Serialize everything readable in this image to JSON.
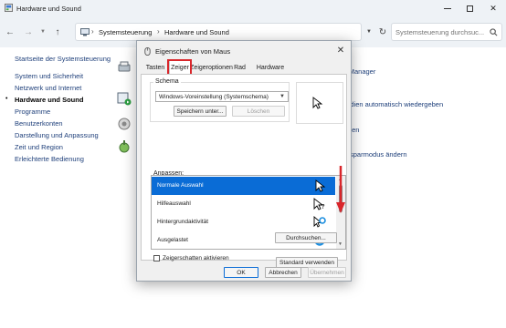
{
  "window": {
    "title": "Hardware und Sound",
    "controls": {
      "minimize": "minimize",
      "maximize": "maximize",
      "close": "✕"
    }
  },
  "address": {
    "breadcrumbs": [
      "Systemsteuerung",
      "Hardware und Sound"
    ],
    "separator": "›",
    "search_placeholder": "Systemsteuerung durchsuc..."
  },
  "sidebar": {
    "items": [
      {
        "label": "Startseite der Systemsteuerung",
        "active": false
      },
      {
        "label": "System und Sicherheit",
        "active": false
      },
      {
        "label": "Netzwerk und Internet",
        "active": false
      },
      {
        "label": "Hardware und Sound",
        "active": true
      },
      {
        "label": "Programme",
        "active": false
      },
      {
        "label": "Benutzerkonten",
        "active": false
      },
      {
        "label": "Darstellung und Anpassung",
        "active": false
      },
      {
        "label": "Zeit und Region",
        "active": false
      },
      {
        "label": "Erleichterte Bedienung",
        "active": false
      }
    ]
  },
  "main": {
    "partial_links": [
      "te-Manager",
      "Medien automatisch wiedergeben",
      "halten",
      "giesparmodus ändern"
    ]
  },
  "dialog": {
    "title": "Eigenschaften von Maus",
    "close": "✕",
    "tabs": [
      "Tasten",
      "Zeiger",
      "Zeigeroptionen",
      "Rad",
      "Hardware"
    ],
    "selected_tab": "Zeiger",
    "scheme": {
      "group_label": "Schema",
      "selected": "Windows-Voreinstellung (Systemschema)",
      "save_button": "Speichern unter...",
      "delete_button": "Löschen"
    },
    "customize_label": "Anpassen:",
    "cursors": [
      {
        "name": "Normale Auswahl",
        "icon": "arrow-cursor",
        "selected": true
      },
      {
        "name": "Hilfeauswahl",
        "icon": "help-cursor",
        "selected": false
      },
      {
        "name": "Hintergrundaktivität",
        "icon": "working-cursor",
        "selected": false
      },
      {
        "name": "Ausgelastet",
        "icon": "busy-cursor",
        "selected": false
      }
    ],
    "shadow_checkbox": {
      "label": "Zeigerschatten aktivieren",
      "checked": false
    },
    "default_button": "Standard verwenden",
    "browse_button": "Durchsuchen...",
    "ok_button": "OK",
    "cancel_button": "Abbrechen",
    "apply_button": "Übernehmen"
  },
  "colors": {
    "accent": "#0a6cd6",
    "highlight_red": "#d9262b",
    "link": "#1e3f7a"
  }
}
